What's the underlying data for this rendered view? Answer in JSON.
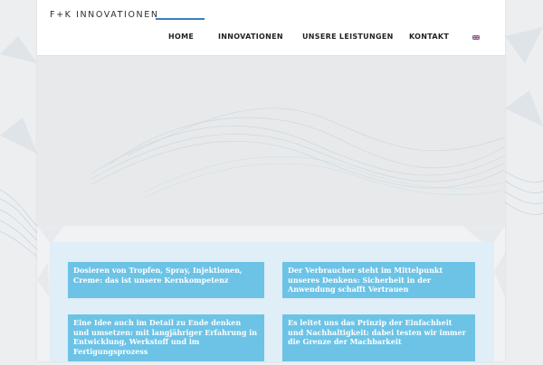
{
  "brand": {
    "logo_text": "F+K INNOVATIONEN",
    "accent_color": "#3a7fc1"
  },
  "nav": {
    "items": [
      {
        "label": "HOME"
      },
      {
        "label": "INNOVATIONEN"
      },
      {
        "label": "UNSERE LEISTUNGEN"
      },
      {
        "label": "KONTAKT"
      }
    ],
    "language_flag": "uk-flag-icon"
  },
  "tiles": [
    {
      "text": "Dosieren von Tropfen, Spray, Injektionen, Creme: das ist unsere Kernkompetenz"
    },
    {
      "text": "Der Verbraucher steht im Mittelpunkt unseres Denkens: Sicherheit in der Anwendung schafft Vertrauen"
    },
    {
      "text": "Eine Idee auch im Detail zu Ende denken und umsetzen: mit langjähriger Erfahrung in Entwicklung, Werkstoff und im Fertigungsprozess"
    },
    {
      "text": "Es leitet uns das Prinzip der Einfachheit und Nachhaltigkeit: dabei testen wir immer die Grenze der Machbarkeit"
    }
  ],
  "colors": {
    "tile": "#6cc3e6",
    "content_box": "#dfeef7",
    "hero": "#e8e9ea"
  }
}
